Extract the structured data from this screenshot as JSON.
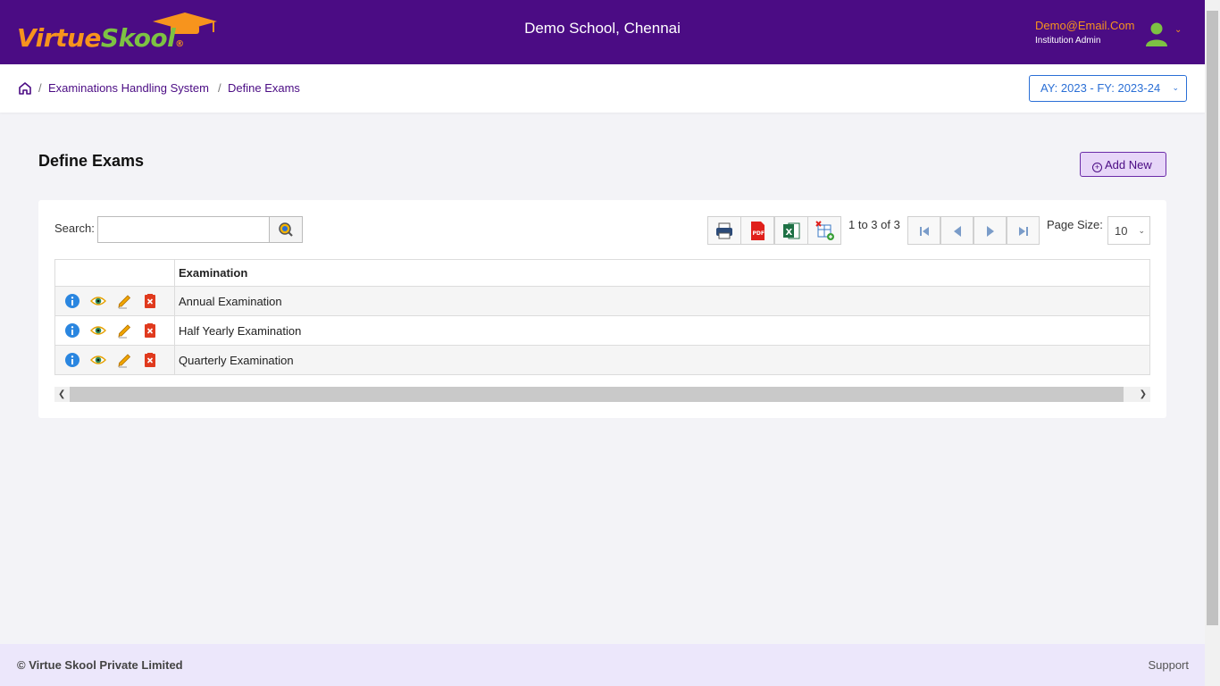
{
  "header": {
    "logo_part1": "Virtue",
    "logo_part2": "Skool",
    "logo_reg": "®",
    "school": "Demo School, Chennai",
    "user_email": "Demo@Email.Com",
    "user_role": "Institution Admin"
  },
  "breadcrumb": {
    "items": [
      "Examinations Handling System",
      "Define Exams"
    ],
    "separator": "/"
  },
  "academic_year": "AY: 2023 - FY: 2023-24",
  "page": {
    "title": "Define Exams",
    "add_label": "Add New"
  },
  "toolbar": {
    "search_label": "Search:",
    "search_value": "",
    "page_info": "1 to 3 of 3",
    "page_size_label": "Page Size:",
    "page_size": "10"
  },
  "table": {
    "columns": [
      "",
      "Examination"
    ],
    "rows": [
      "Annual Examination",
      "Half Yearly Examination",
      "Quarterly Examination"
    ]
  },
  "footer": {
    "copyright": "© Virtue Skool Private Limited",
    "support": "Support"
  },
  "colors": {
    "brand": "#4b0c84",
    "accent_orange": "#f7941d",
    "accent_green": "#7dc243",
    "link_blue": "#2a6fd6"
  }
}
